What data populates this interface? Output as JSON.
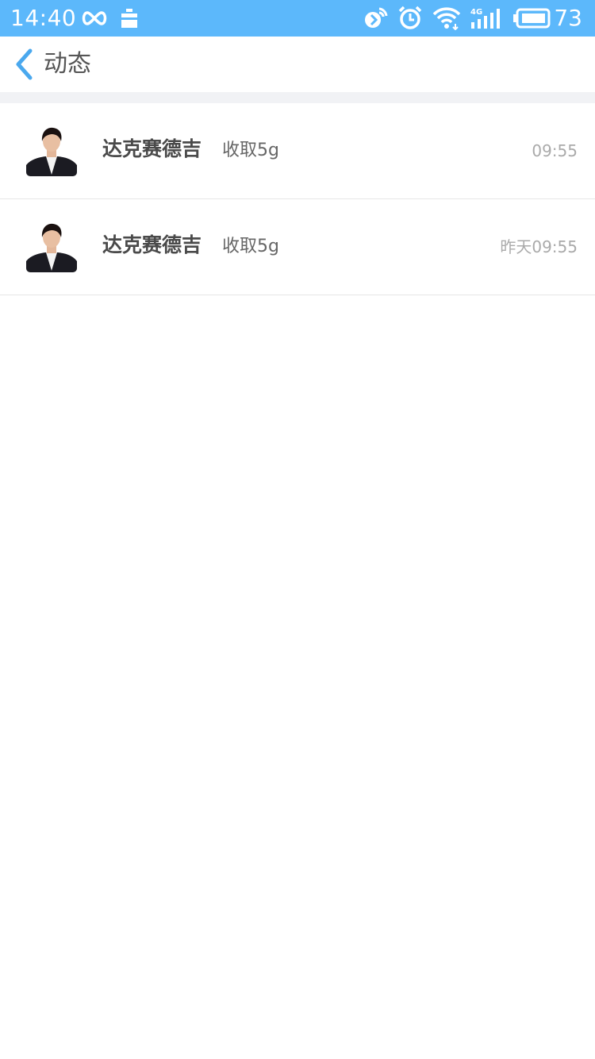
{
  "status_bar": {
    "time": "14:40",
    "battery_level": "73",
    "network": "4G",
    "background_color": "#5cb8fb",
    "icons": [
      "infinity-icon",
      "notification-icon",
      "data-saver-icon",
      "alarm-icon",
      "wifi-icon",
      "signal-icon",
      "battery-icon"
    ]
  },
  "nav": {
    "title": "动态",
    "back_icon": "chevron-left-icon",
    "accent_color": "#4aa8ee"
  },
  "feed": {
    "items": [
      {
        "name": "达克赛德吉",
        "action": "收取5g",
        "time": "09:55",
        "avatar_icon": "user-avatar"
      },
      {
        "name": "达克赛德吉",
        "action": "收取5g",
        "time": "昨天09:55",
        "avatar_icon": "user-avatar"
      }
    ]
  }
}
